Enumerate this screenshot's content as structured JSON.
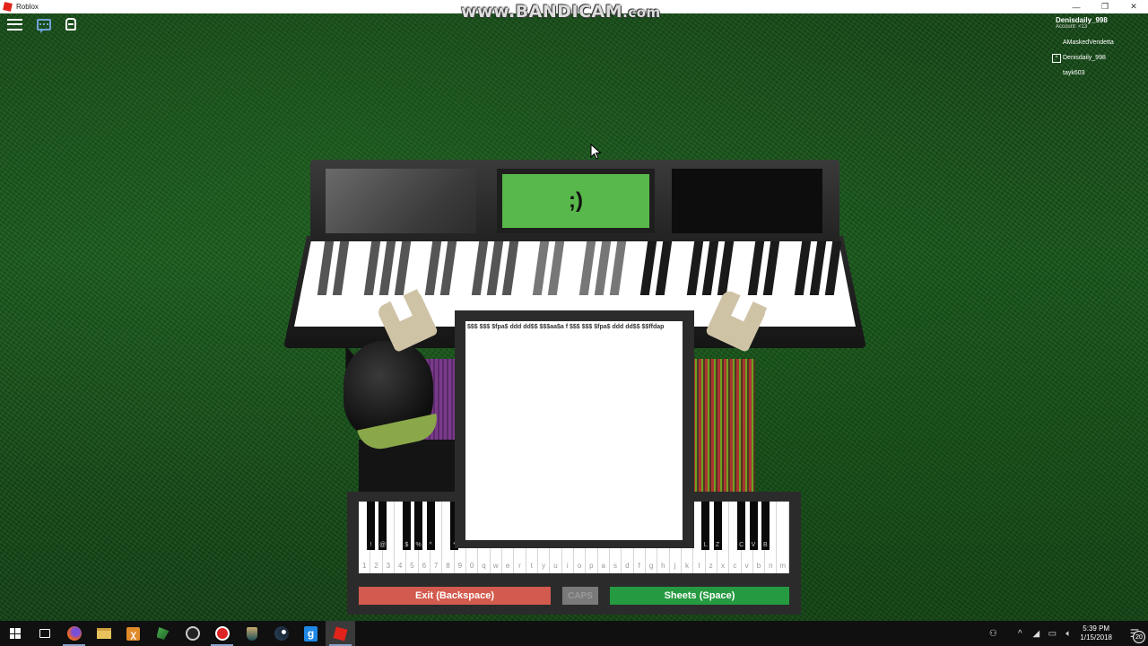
{
  "window": {
    "title": "Roblox",
    "minimize_glyph": "—",
    "maximize_glyph": "❐",
    "close_glyph": "✕"
  },
  "watermark": {
    "main": "www.BANDICAM",
    "suffix": ".com"
  },
  "topbar": {
    "icons": [
      "menu-icon",
      "chat-icon",
      "backpack-icon"
    ]
  },
  "playerlist": {
    "self_name": "Denisdaily_998",
    "self_account": "Account: <13",
    "players": [
      {
        "name": "AMaskedVendetta",
        "badge": ""
      },
      {
        "name": "Denisdaily_998",
        "badge": "^"
      },
      {
        "name": "tayk603",
        "badge": ""
      }
    ]
  },
  "piano_display": {
    "center_text": ";)",
    "center_color": "#58b84b"
  },
  "sheet": {
    "text": "$$$ $$$ $fpa$ ddd dd$$ $$$aa$a f $$$ $$$ $fpa$ ddd dd$$ $$ffdap"
  },
  "gui_piano": {
    "white_keys": [
      "1",
      "2",
      "3",
      "4",
      "5",
      "6",
      "7",
      "8",
      "9",
      "0",
      "q",
      "w",
      "e",
      "r",
      "t",
      "y",
      "u",
      "i",
      "o",
      "p",
      "a",
      "s",
      "d",
      "f",
      "g",
      "h",
      "j",
      "k",
      "l",
      "z",
      "x",
      "c",
      "v",
      "b",
      "n",
      "m"
    ],
    "black_keys_visible": [
      {
        "after_index": 0,
        "label": "!"
      },
      {
        "after_index": 1,
        "label": "@"
      },
      {
        "after_index": 3,
        "label": "$"
      },
      {
        "after_index": 4,
        "label": "%"
      },
      {
        "after_index": 5,
        "label": "^"
      },
      {
        "after_index": 7,
        "label": "*"
      },
      {
        "after_index": 28,
        "label": "L"
      },
      {
        "after_index": 29,
        "label": "Z"
      },
      {
        "after_index": 31,
        "label": "C"
      },
      {
        "after_index": 32,
        "label": "V"
      },
      {
        "after_index": 33,
        "label": "B"
      }
    ],
    "buttons": {
      "exit": "Exit (Backspace)",
      "caps": "CAPS",
      "sheets": "Sheets (Space)"
    },
    "colors": {
      "exit": "#d35a4e",
      "caps": "#7a7a7a",
      "sheets": "#259a40"
    }
  },
  "taskbar": {
    "apps": [
      {
        "name": "start",
        "icon": "windows-icon"
      },
      {
        "name": "task-view",
        "icon": "task-view-icon"
      },
      {
        "name": "firefox",
        "icon": "firefox-icon",
        "active": true
      },
      {
        "name": "file-explorer",
        "icon": "folder-icon"
      },
      {
        "name": "xampp",
        "icon": "xampp-icon"
      },
      {
        "name": "app-green",
        "icon": "green-app-icon"
      },
      {
        "name": "obs",
        "icon": "obs-icon"
      },
      {
        "name": "bandicam",
        "icon": "record-icon",
        "active": true
      },
      {
        "name": "league-of-legends",
        "icon": "lol-icon"
      },
      {
        "name": "steam",
        "icon": "steam-icon"
      },
      {
        "name": "garrys-mod",
        "icon": "gmod-icon"
      },
      {
        "name": "roblox",
        "icon": "roblox-icon",
        "active": true,
        "focused": true
      }
    ],
    "time": "5:39 PM",
    "date": "1/15/2018",
    "notifications": "20"
  }
}
